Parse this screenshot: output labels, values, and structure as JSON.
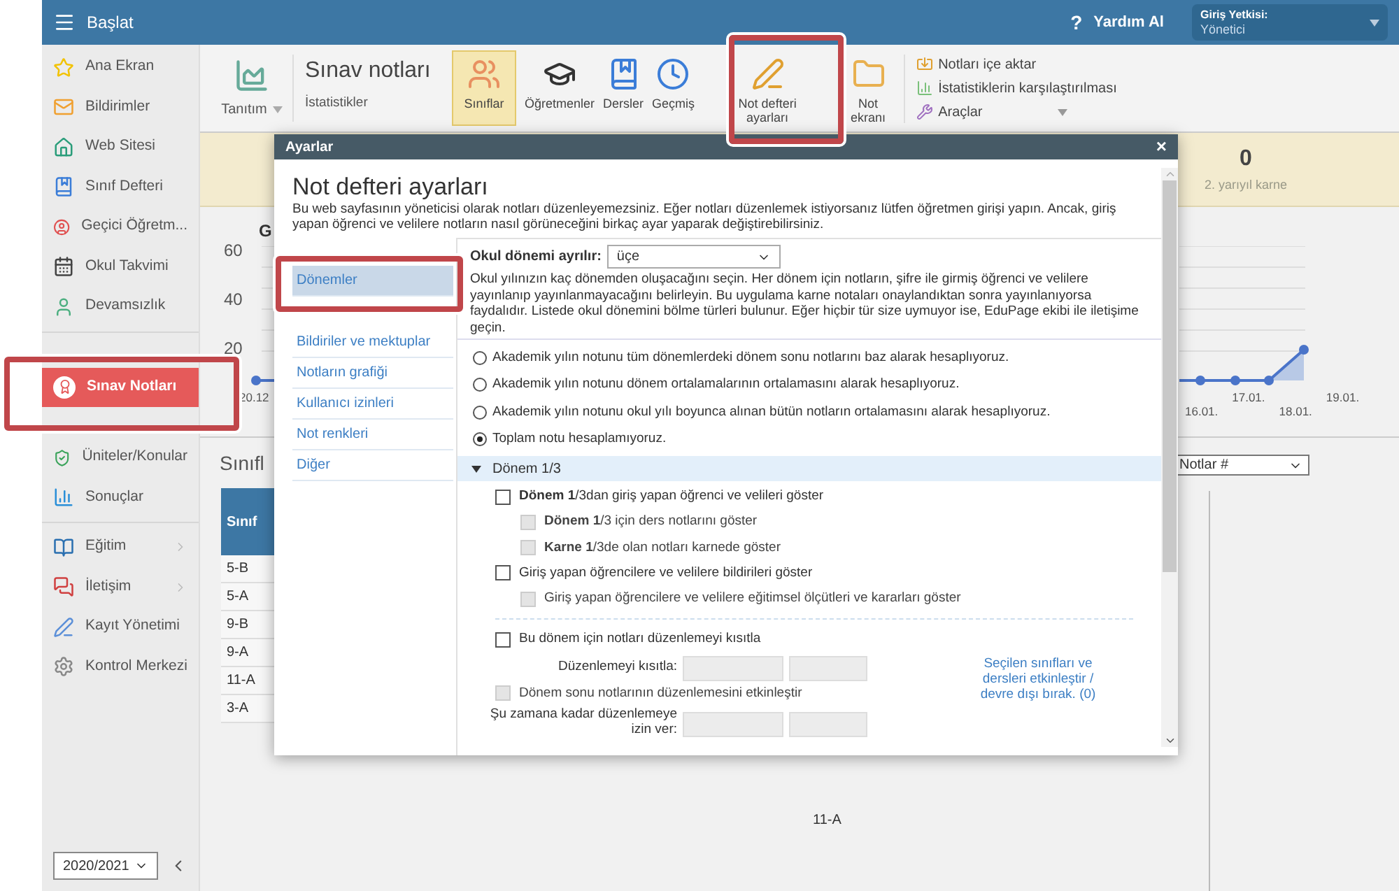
{
  "top_bar": {
    "title": "Başlat",
    "help_icon": "?",
    "help": "Yardım Al",
    "role_label": "Giriş Yetkisi:",
    "role_value": "Yönetici"
  },
  "sidebar": {
    "items": [
      {
        "kind": "item",
        "label": "Ana Ekran",
        "selected": false,
        "submenu": false
      },
      {
        "kind": "item",
        "label": "Bildirimler",
        "selected": false,
        "submenu": false
      },
      {
        "kind": "item",
        "label": "Web Sitesi",
        "selected": false,
        "submenu": false
      },
      {
        "kind": "item",
        "label": "Sınıf Defteri",
        "selected": false,
        "submenu": false
      },
      {
        "kind": "item",
        "label": "Geçici Öğretm...",
        "selected": false,
        "submenu": false
      },
      {
        "kind": "item",
        "label": "Okul Takvimi",
        "selected": false,
        "submenu": false
      },
      {
        "kind": "item",
        "label": "Devamsızlık",
        "selected": false,
        "submenu": false
      },
      {
        "kind": "divider"
      },
      {
        "kind": "item",
        "label": "Sınav Notları",
        "selected": true,
        "submenu": false
      },
      {
        "kind": "item",
        "label": "Üniteler/Konular",
        "selected": false,
        "submenu": false
      },
      {
        "kind": "item",
        "label": "Sonuçlar",
        "selected": false,
        "submenu": false
      },
      {
        "kind": "divider"
      },
      {
        "kind": "item",
        "label": "Eğitim",
        "selected": false,
        "submenu": true
      },
      {
        "kind": "item",
        "label": "İletişim",
        "selected": false,
        "submenu": true
      },
      {
        "kind": "item",
        "label": "Kayıt Yönetimi",
        "selected": false,
        "submenu": false
      },
      {
        "kind": "item",
        "label": "Kontrol Merkezi",
        "selected": false,
        "submenu": false
      }
    ],
    "year": "2020/2021"
  },
  "toolbar": {
    "intro": "Tanıtım",
    "title": "Sınav notları",
    "subtitle": "İstatistikler",
    "buttons": [
      {
        "label": "Sınıflar",
        "selected": true
      },
      {
        "label": "Öğretmenler",
        "selected": false
      },
      {
        "label": "Dersler",
        "selected": false
      },
      {
        "label": "Geçmiş",
        "selected": false
      },
      {
        "label": "Not defteri ayarları",
        "selected": false
      },
      {
        "label": "Not ekranı",
        "selected": false
      }
    ],
    "links": [
      {
        "label": "Notları içe aktar",
        "dropdown": false
      },
      {
        "label": "İstatistiklerin karşılaştırılması",
        "dropdown": false
      },
      {
        "label": "Araçlar",
        "dropdown": true
      }
    ]
  },
  "summary": {
    "value": "0",
    "label": "2. yarıyıl karne"
  },
  "chart": {
    "title": "G",
    "y_labels": [
      "60",
      "40",
      "20"
    ],
    "x_labels": [
      "20.12",
      "16.01.",
      "17.01.",
      "18.01.",
      "19.01."
    ]
  },
  "classes": {
    "heading": "Sınıfl",
    "column": "Sınıf",
    "rows": [
      "5-B",
      "5-A",
      "9-B",
      "9-A",
      "11-A",
      "3-A"
    ],
    "metric": "Notlar #",
    "axis_label": "11-A"
  },
  "modal": {
    "title": "Ayarlar",
    "close": "×",
    "heading": "Not defteri ayarları",
    "description": "Bu web sayfasının yöneticisi olarak notları düzenleyemezsiniz. Eğer notları düzenlemek istiyorsanız lütfen öğretmen girişi yapın. Ancak, giriş yapan öğrenci ve velilere notların nasıl görüneceğini birkaç ayar yaparak değiştirebilirsiniz.",
    "nav": [
      {
        "label": "Dönemler",
        "selected": true
      },
      {
        "label": "Bildiriler ve mektuplar",
        "selected": false
      },
      {
        "label": "Notların grafiği",
        "selected": false
      },
      {
        "label": "Kullanıcı izinleri",
        "selected": false
      },
      {
        "label": "Not renkleri",
        "selected": false
      },
      {
        "label": "Diğer",
        "selected": false
      }
    ],
    "period_label": "Okul dönemi ayrılır:",
    "period_value": "üçe",
    "period_help": "Okul yılınızın kaç dönemden oluşacağını seçin. Her dönem için notların, şifre ile girmiş öğrenci ve velilere yayınlanıp yayınlanmayacağını belirleyin. Bu uygulama karne notaları onaylandıktan sonra yayınlanıyorsa faydalıdır. Listede okul dönemini bölme türleri bulunur. Eğer hiçbir tür size uymuyor ise, EduPage ekibi ile iletişime geçin.",
    "calc_options": [
      {
        "label": "Akademik yılın notunu tüm dönemlerdeki dönem sonu notlarını baz alarak hesaplıyoruz.",
        "selected": false
      },
      {
        "label": "Akademik yılın notunu dönem ortalamalarının ortalamasını alarak hesaplıyoruz.",
        "selected": false
      },
      {
        "label": "Akademik yılın notunu okul yılı boyunca alınan bütün notların ortalamasını alarak hesaplıyoruz.",
        "selected": false
      },
      {
        "label": "Toplam notu hesaplamıyoruz.",
        "selected": true
      }
    ],
    "section": {
      "title": "Dönem 1/3",
      "expanded": true,
      "options": [
        {
          "label": "**Dönem 1**/3dan giriş yapan öğrenci ve velileri göster",
          "checked": false,
          "disabled": false,
          "children": [
            {
              "label": "**Dönem 1**/3 için ders notlarını göster",
              "checked": false,
              "disabled": true
            },
            {
              "label": "**Karne 1**/3de olan notları karnede göster",
              "checked": false,
              "disabled": true
            }
          ]
        },
        {
          "label": "Giriş yapan öğrencilere ve velilere bildirileri göster",
          "checked": false,
          "disabled": false,
          "children": [
            {
              "label": "Giriş yapan öğrencilere ve velilere eğitimsel ölçütleri ve kararları göster",
              "checked": false,
              "disabled": true
            }
          ]
        }
      ],
      "restrict": {
        "label": "Bu dönem için notları düzenlemeyi kısıtla",
        "checked": false,
        "disabled": false
      },
      "limit_label": "Düzenlemeyi kısıtla:",
      "end_edit": {
        "label": "Dönem sonu notlarının düzenlemesini etkinleştir",
        "checked": false,
        "disabled": true
      },
      "until_label": "Şu zamana kadar düzenlemeye izin ver:",
      "link": "Seçilen sınıfları ve dersleri etkinleştir / devre dışı bırak. (0)"
    }
  }
}
